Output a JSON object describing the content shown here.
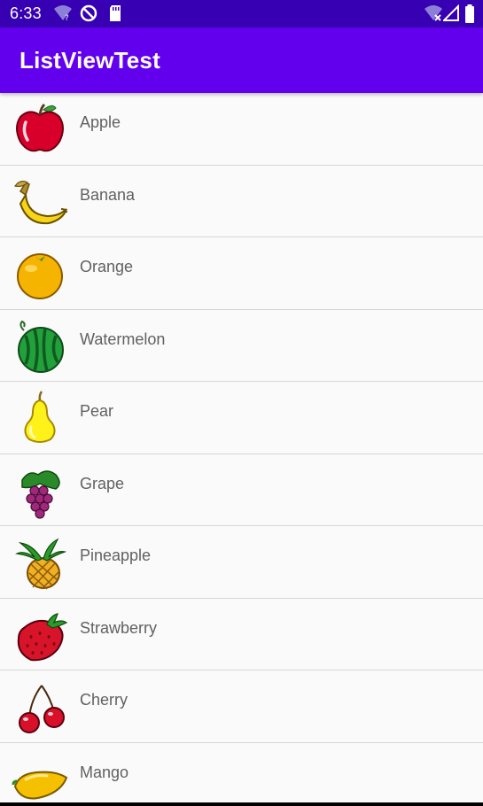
{
  "status_bar": {
    "time": "6:33"
  },
  "app_bar": {
    "title": "ListViewTest"
  },
  "fruits": [
    {
      "name": "Apple",
      "icon": "apple-icon"
    },
    {
      "name": "Banana",
      "icon": "banana-icon"
    },
    {
      "name": "Orange",
      "icon": "orange-icon"
    },
    {
      "name": "Watermelon",
      "icon": "watermelon-icon"
    },
    {
      "name": "Pear",
      "icon": "pear-icon"
    },
    {
      "name": "Grape",
      "icon": "grape-icon"
    },
    {
      "name": "Pineapple",
      "icon": "pineapple-icon"
    },
    {
      "name": "Strawberry",
      "icon": "strawberry-icon"
    },
    {
      "name": "Cherry",
      "icon": "cherry-icon"
    },
    {
      "name": "Mango",
      "icon": "mango-icon"
    }
  ],
  "colors": {
    "status_bar": "#3700b3",
    "app_bar": "#6200ee",
    "background": "#fafafa",
    "divider": "#d6d6d6",
    "item_text": "#616161"
  }
}
